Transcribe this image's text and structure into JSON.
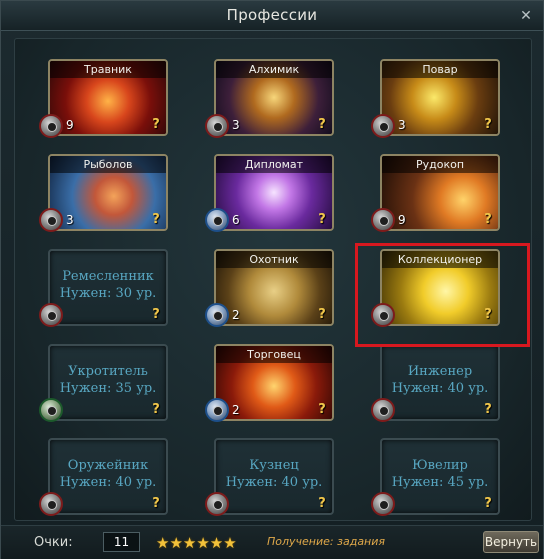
{
  "window": {
    "title": "Профессии",
    "close_icon": "close-icon"
  },
  "professions": [
    {
      "name": "Травник",
      "level": "9",
      "locked": false
    },
    {
      "name": "Алхимик",
      "level": "3",
      "locked": false
    },
    {
      "name": "Повар",
      "level": "3",
      "locked": false
    },
    {
      "name": "Рыболов",
      "level": "3",
      "locked": false
    },
    {
      "name": "Дипломат",
      "level": "6",
      "locked": false
    },
    {
      "name": "Рудокоп",
      "level": "9",
      "locked": false
    },
    {
      "name": "Ремесленник",
      "requirement": "Нужен: 30 ур.",
      "locked": true
    },
    {
      "name": "Охотник",
      "level": "2",
      "locked": false
    },
    {
      "name": "Коллекционер",
      "level": "",
      "locked": false
    },
    {
      "name": "Укротитель",
      "requirement": "Нужен: 35 ур.",
      "locked": true
    },
    {
      "name": "Торговец",
      "level": "2",
      "locked": false
    },
    {
      "name": "Инженер",
      "requirement": "Нужен: 40 ур.",
      "locked": true
    },
    {
      "name": "Оружейник",
      "requirement": "Нужен: 40 ур.",
      "locked": true
    },
    {
      "name": "Кузнец",
      "requirement": "Нужен: 40 ур.",
      "locked": true
    },
    {
      "name": "Ювелир",
      "requirement": "Нужен: 45 ур.",
      "locked": true
    }
  ],
  "help_glyph": "?",
  "footer": {
    "points_label": "Очки:",
    "points_value": "11",
    "stars": "★★★★★★",
    "gain_text": "Получение: задания",
    "return_label": "Вернуть"
  },
  "colors": {
    "accent_gold": "#f0c64a",
    "locked_text": "#58a7c2",
    "highlight_red": "#d8181f"
  }
}
